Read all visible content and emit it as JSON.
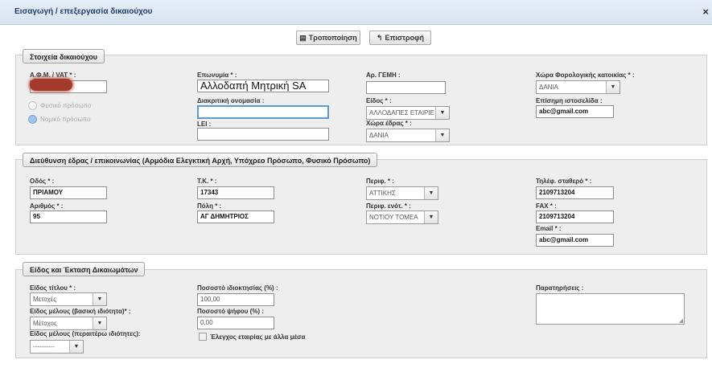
{
  "window": {
    "title": "Εισαγωγή / επεξεργασία δικαιούχου",
    "close": "×"
  },
  "toolbar": {
    "edit_icon": "▤",
    "edit_label": "Τροποποίηση",
    "back_icon": "↰",
    "back_label": "Επιστροφή"
  },
  "section1": {
    "legend": "Στοιχεία δικαιούχου",
    "vat_label": "Α.Φ.Μ. / VAT * :",
    "vat_value": "",
    "natural_person": "Φυσικό πρόσωπο",
    "legal_person": "Νομικό πρόσωπο",
    "name_label": "Επωνυμία * :",
    "name_value": "Αλλοδαπή Μητρική SA",
    "distinctive_label": "Διακριτική ονομασία :",
    "distinctive_value": "",
    "lei_label": "LEI :",
    "lei_value": "",
    "gemi_label": "Αρ. ΓΕΜΗ :",
    "gemi_value": "",
    "type_label": "Είδος * :",
    "type_value": "ΑΛΛΟΔΑΠΕΣ ΕΤΑΙΡΙΕ",
    "seat_country_label": "Χώρα έδρας * :",
    "seat_country_value": "ΔΑΝΙΑ",
    "tax_country_label": "Χώρα Φορολογικής κατοικίας * :",
    "tax_country_value": "ΔΑΝΙΑ",
    "website_label": "Επίσημη ιστοσελίδα :",
    "website_value": "abc@gmail.com"
  },
  "section2": {
    "legend": "Διεύθυνση έδρας / επικοινωνίας (Αρμόδια Ελεγκτική Αρχή, Υπόχρεο Πρόσωπο, Φυσικό Πρόσωπο)",
    "street_label": "Οδός * :",
    "street_value": "ΠΡΙΑΜΟΥ",
    "number_label": "Αριθμός * :",
    "number_value": "95",
    "zip_label": "Τ.Κ. * :",
    "zip_value": "17343",
    "city_label": "Πόλη * :",
    "city_value": "ΑΓ ΔΗΜΗΤΡΙΟΣ",
    "region_label": "Περιφ. * :",
    "region_value": "ΑΤΤΙΚΗΣ",
    "region_unit_label": "Περιφ. ενότ. * :",
    "region_unit_value": "ΝΟΤΙΟΥ ΤΟΜΕΑ",
    "phone_label": "Τηλέφ. σταθερό * :",
    "phone_value": "2109713204",
    "fax_label": "FAX * :",
    "fax_value": "2109713204",
    "email_label": "Email * :",
    "email_value": "abc@gmail.com"
  },
  "section3": {
    "legend": "Είδος και Έκταση Δικαιωμάτων",
    "title_type_label": "Είδος τίτλου * :",
    "title_type_value": "Μετοχές",
    "member_basic_label": "Είδος μέλους (βασική ιδιότητα)* :",
    "member_basic_value": "Μέτοχος",
    "member_extra_label": "Είδος μέλους (περαιτέρω ιδιότητες):",
    "member_extra_value": "----------",
    "ownership_label": "Ποσοστό ιδιοκτησίας (%) :",
    "ownership_value": "100,00",
    "vote_label": "Ποσοστό ψήφου (%) :",
    "vote_value": "0,00",
    "control_label": "Έλεγχος εταιρίας με άλλα μέσα",
    "notes_label": "Παρατηρήσεις :",
    "notes_value": ""
  },
  "colors": {
    "accent": "#5b9bd5",
    "title": "#1c3d6e",
    "panel": "#eeeeee",
    "redaction": "#a33a2c"
  }
}
